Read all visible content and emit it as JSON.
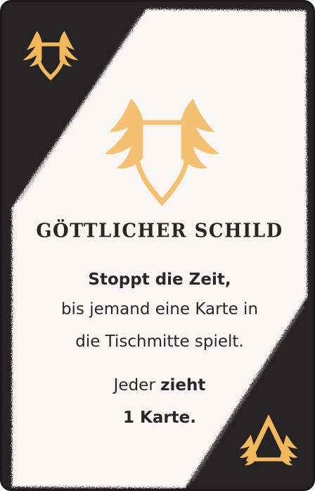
{
  "card": {
    "title": "GÖTTLICHER SCHILD",
    "effect_bold": "Stoppt die Zeit,",
    "effect_line2": "bis jemand eine Karte in",
    "effect_line3": "die Tischmitte spielt.",
    "draw_prefix": "Jeder ",
    "draw_bold": "zieht",
    "draw_line2": "1 Karte.",
    "icons": {
      "top_left": "winged-shield-icon",
      "center": "winged-shield-icon",
      "bottom_right": "winged-triangle-icon"
    },
    "colors": {
      "border": "#262324",
      "panel": "#f7f6f4",
      "icon_gold": "#f2b85a",
      "text": "#2b2728"
    }
  }
}
